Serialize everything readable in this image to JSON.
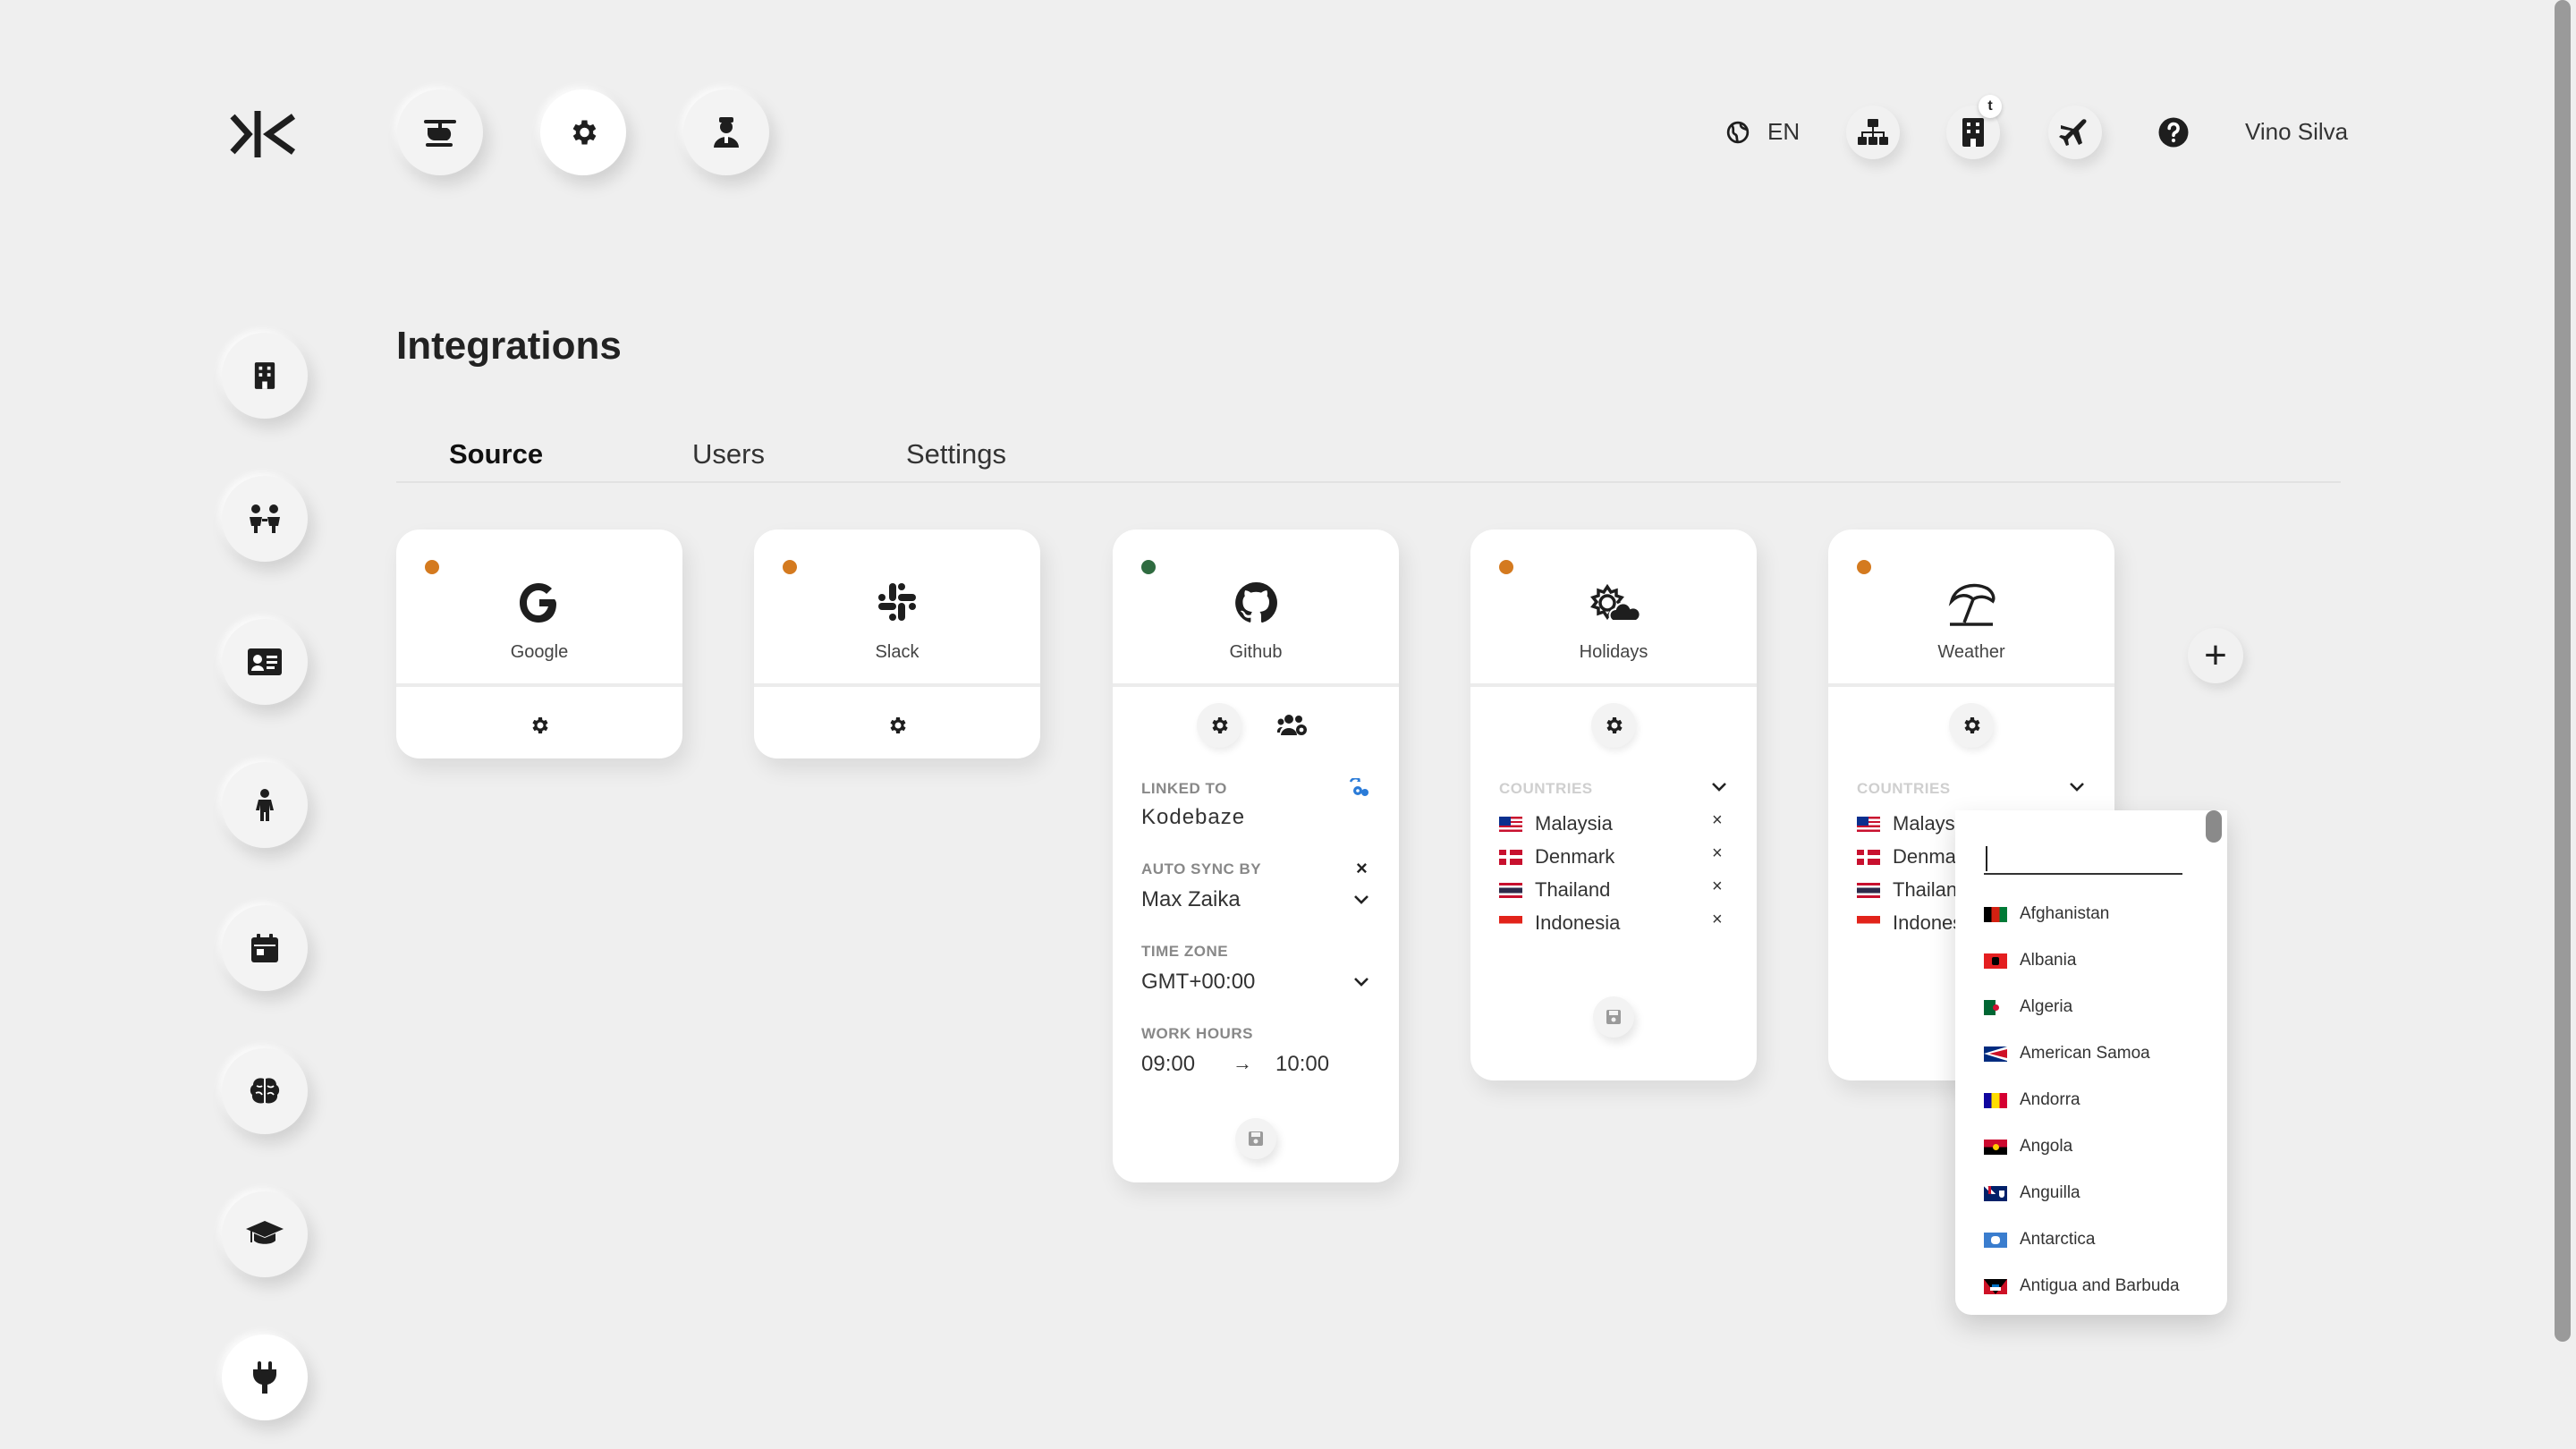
{
  "header": {
    "language_code": "EN",
    "user_name": "Vino Silva",
    "company_badge": "t",
    "top_nav": [
      {
        "icon": "helicopter-icon"
      },
      {
        "icon": "gear-icon",
        "active": true
      },
      {
        "icon": "user-tie-icon"
      }
    ],
    "right_icons": [
      "sitemap-icon",
      "building-icon",
      "plane-icon",
      "help-icon"
    ]
  },
  "sidebar": {
    "items": [
      {
        "icon": "building-icon"
      },
      {
        "icon": "people-icon"
      },
      {
        "icon": "id-card-icon"
      },
      {
        "icon": "person-icon"
      },
      {
        "icon": "calendar-icon"
      },
      {
        "icon": "brain-icon"
      },
      {
        "icon": "graduation-cap-icon"
      },
      {
        "icon": "plug-icon",
        "active": true
      }
    ]
  },
  "page": {
    "title": "Integrations",
    "tabs": [
      {
        "label": "Source",
        "active": true
      },
      {
        "label": "Users"
      },
      {
        "label": "Settings"
      }
    ]
  },
  "cards": {
    "google": {
      "name": "Google",
      "status_color": "#d47a1f"
    },
    "slack": {
      "name": "Slack",
      "status_color": "#d47a1f"
    },
    "github": {
      "name": "Github",
      "status_color": "#2f6b40",
      "linked_to_label": "LINKED TO",
      "linked_to_value": "Kodebaze",
      "auto_sync_label": "AUTO SYNC BY",
      "auto_sync_value": "Max Zaika",
      "time_zone_label": "TIME ZONE",
      "time_zone_value": "GMT+00:00",
      "work_hours_label": "WORK HOURS",
      "work_start": "09:00",
      "work_end": "10:00",
      "arrow": "→"
    },
    "holidays": {
      "name": "Holidays",
      "status_color": "#d47a1f",
      "countries_label": "COUNTRIES",
      "countries": [
        "Malaysia",
        "Denmark",
        "Thailand",
        "Indonesia"
      ],
      "remove_glyph": "×"
    },
    "weather": {
      "name": "Weather",
      "status_color": "#d47a1f",
      "countries_label": "COUNTRIES",
      "countries": [
        "Malaysia",
        "Denmar",
        "Thailanc",
        "Indones"
      ]
    }
  },
  "add_glyph": "+",
  "dropdown": {
    "search_value": "",
    "options": [
      "Afghanistan",
      "Albania",
      "Algeria",
      "American Samoa",
      "Andorra",
      "Angola",
      "Anguilla",
      "Antarctica",
      "Antigua and Barbuda"
    ]
  },
  "colors": {
    "background": "#efefef",
    "status_orange": "#d47a1f",
    "status_green": "#2f6b40",
    "link_blue": "#2a7bd8"
  }
}
